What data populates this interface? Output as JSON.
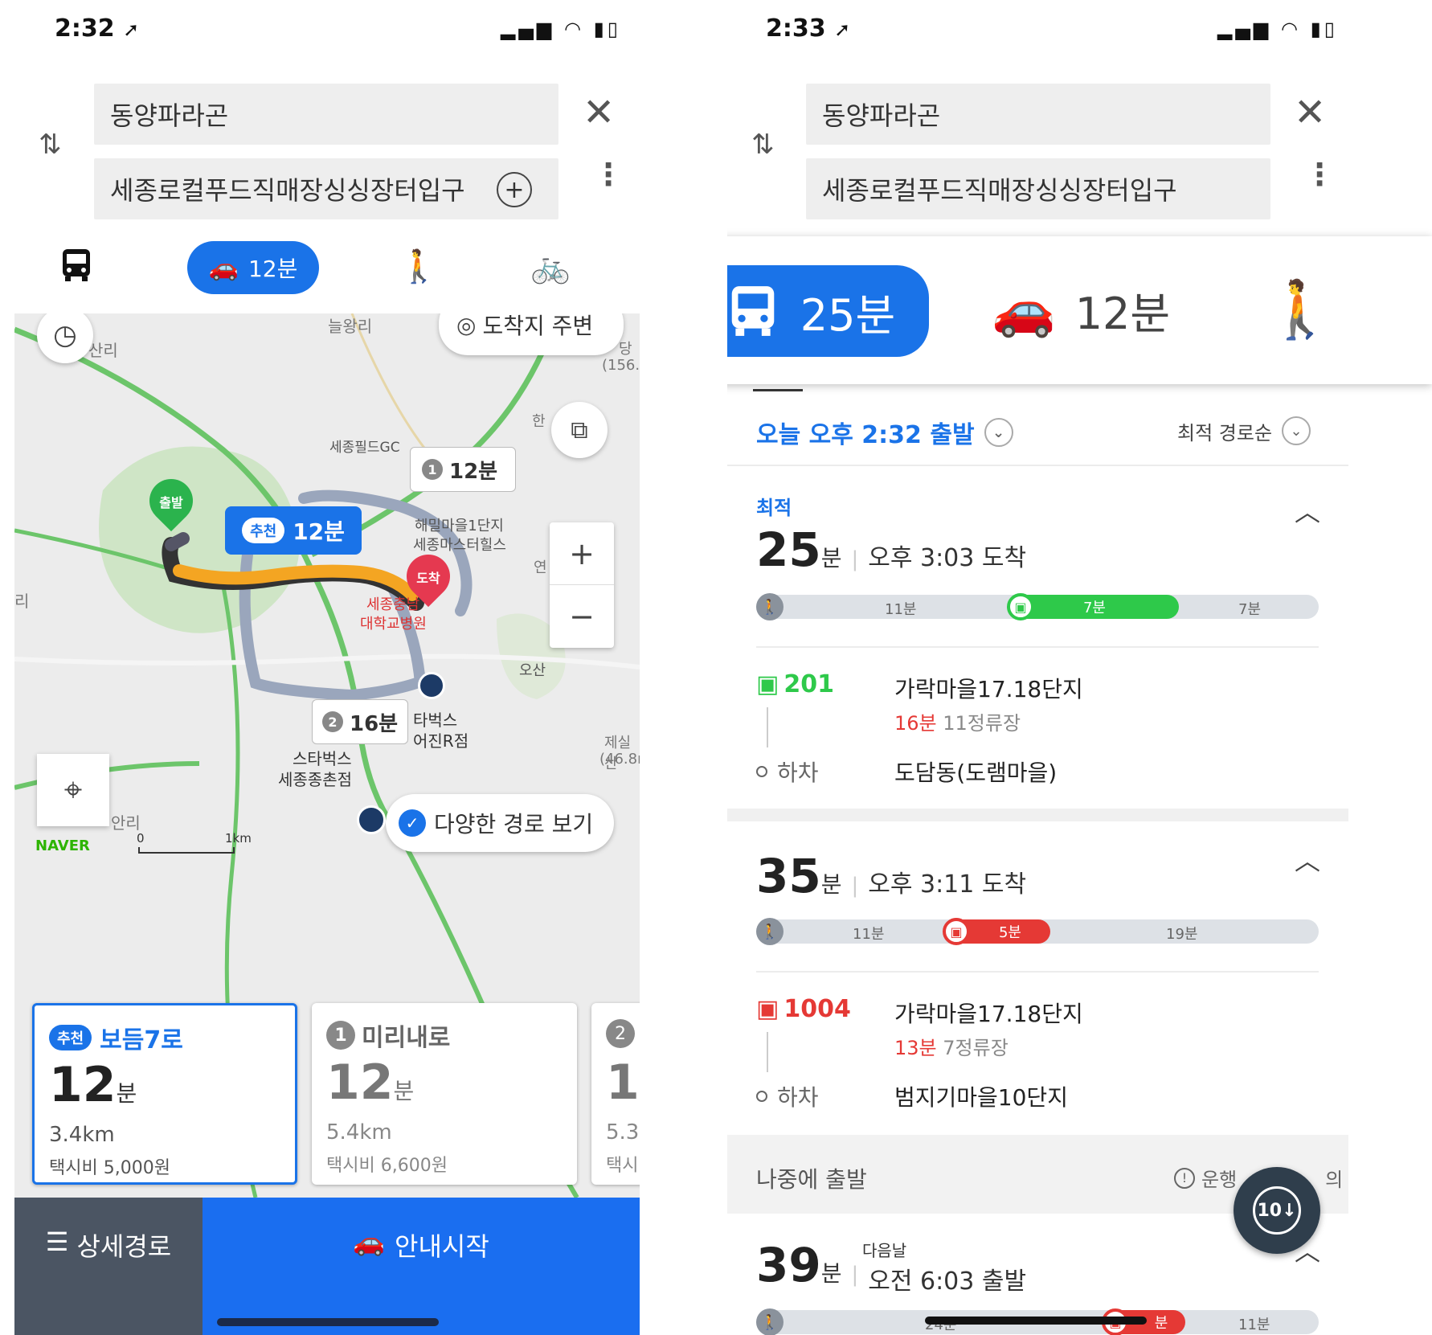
{
  "left": {
    "status": {
      "time": "2:32",
      "arrow": "➚"
    },
    "search": {
      "origin": "동양파라곤",
      "destination": "세종로컬푸드직매장싱싱장터입구"
    },
    "modes": {
      "car_time": "12분"
    },
    "map": {
      "labels": {
        "l1": "늘왕리",
        "l2": "산리",
        "l3": "세종필드GC",
        "l4": "해밀마을1단지",
        "l5": "세종마스터힐스",
        "l6": "세종충남",
        "l7": "대학교병원",
        "l8": "오산",
        "l9": "타벅스",
        "l10": "어진R점",
        "l11": "스타벅스",
        "l12": "세종종촌점",
        "l13": "안리",
        "l14": "제실산",
        "l15": "(46.8m",
        "l16": "(156.",
        "l17": "리",
        "l18": "연",
        "l19": "한",
        "l20": "당"
      },
      "arrival_chip": "도착지 주변",
      "start_pin": "출발",
      "end_pin": "도착",
      "rec_badge": "추천",
      "rec_time": "12분",
      "alt1_num": "1",
      "alt1_time": "12분",
      "alt2_num": "2",
      "alt2_time": "16분",
      "more_routes": "다양한 경로 보기",
      "brand": "NAVER",
      "scale_zero": "0",
      "scale_km": "1km",
      "zoom_in": "+",
      "zoom_out": "−"
    },
    "cards": [
      {
        "badge": "추천",
        "name": "보듬7로",
        "time": "12",
        "unit": "분",
        "dist": "3.4km",
        "taxi": "택시비 5,000원"
      },
      {
        "badge": "1",
        "name": "미리내로",
        "time": "12",
        "unit": "분",
        "dist": "5.4km",
        "taxi": "택시비 6,600원"
      },
      {
        "badge": "2",
        "time": "1",
        "dist": "5.3",
        "taxi": "택시"
      }
    ],
    "bottom": {
      "detail": "상세경로",
      "start_nav": "안내시작"
    }
  },
  "right": {
    "status": {
      "time": "2:33",
      "arrow": "➚"
    },
    "search": {
      "origin": "동양파라곤",
      "destination": "세종로컬푸드직매장싱싱장터입구"
    },
    "modes": {
      "bus_time": "25분",
      "car_time": "12분"
    },
    "depart": {
      "label": "오늘 오후 2:32 출발",
      "sort": "최적 경로순"
    },
    "routes": [
      {
        "tag": "최적",
        "time": "25",
        "unit": "분",
        "arrival": "오후 3:03 도착",
        "segments": {
          "walk1": "11분",
          "bus": "7분",
          "walk2": "7분"
        },
        "bus_no": "201",
        "board": "가락마을17.18단지",
        "wait": "16분",
        "stops": "11정류장",
        "alight_label": "하차",
        "alight": "도담동(도램마을)"
      },
      {
        "time": "35",
        "unit": "분",
        "arrival": "오후 3:11 도착",
        "segments": {
          "walk1": "11분",
          "bus": "5분",
          "walk2": "19분"
        },
        "bus_no": "1004",
        "board": "가락마을17.18단지",
        "wait": "13분",
        "stops": "7정류장",
        "alight_label": "하차",
        "alight": "범지기마을10단지"
      }
    ],
    "later": {
      "label": "나중에 출발",
      "note": "운행",
      "note2": "의",
      "fab": "10"
    },
    "route3": {
      "time": "39",
      "unit": "분",
      "next_day": "다음날",
      "depart": "오전 6:03 출발",
      "seg_w": "11분",
      "seg_bus": "분",
      "seg_walk0": "24분"
    }
  },
  "colors": {
    "blue": "#1a73e8",
    "green": "#2ec94a",
    "red": "#e53935",
    "route_orange": "#f4a522"
  }
}
